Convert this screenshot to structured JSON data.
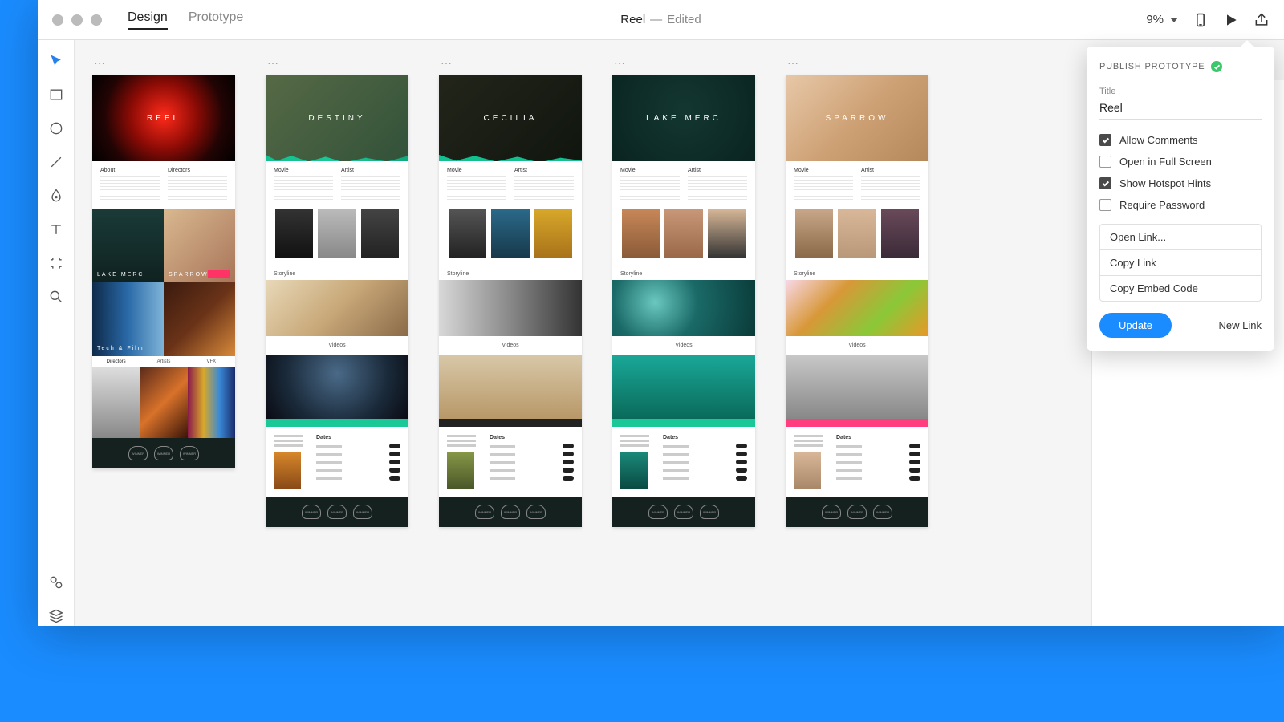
{
  "header": {
    "tabs": {
      "design": "Design",
      "prototype": "Prototype"
    },
    "doc_name": "Reel",
    "doc_sep": "—",
    "doc_status": "Edited",
    "zoom": "9%"
  },
  "tools": {
    "select": "select",
    "rect": "rectangle",
    "ellipse": "ellipse",
    "line": "line",
    "pen": "pen",
    "text": "text",
    "artboard": "artboard",
    "zoom": "zoom",
    "assets": "assets",
    "layers": "layers"
  },
  "artboards": [
    {
      "title": "REEL",
      "cols": [
        "About",
        "Directors"
      ],
      "cells": [
        "LAKE MERC",
        "SPARROW",
        "Tech & Film",
        ""
      ],
      "tabs": [
        "Directors",
        "Artists",
        "VFX"
      ]
    },
    {
      "title": "DESTINY",
      "cols": [
        "Movie",
        "Artist"
      ],
      "section": "Storyline",
      "videos": "Videos",
      "dates": "Dates"
    },
    {
      "title": "CECILIA",
      "cols": [
        "Movie",
        "Artist"
      ],
      "section": "Storyline",
      "videos": "Videos",
      "dates": "Dates"
    },
    {
      "title": "LAKE MERC",
      "cols": [
        "Movie",
        "Artist"
      ],
      "section": "Storyline",
      "videos": "Videos",
      "dates": "Dates"
    },
    {
      "title": "SPARROW",
      "cols": [
        "Movie",
        "Artist"
      ],
      "section": "Storyline",
      "videos": "Videos",
      "dates": "Dates"
    }
  ],
  "footer_badge": "WINNER",
  "popover": {
    "heading": "PUBLISH PROTOTYPE",
    "title_label": "Title",
    "title_value": "Reel",
    "allow_comments": "Allow Comments",
    "fullscreen": "Open in Full Screen",
    "hotspots": "Show Hotspot Hints",
    "password": "Require Password",
    "open_link": "Open Link...",
    "copy_link": "Copy Link",
    "copy_embed": "Copy Embed Code",
    "update": "Update",
    "new_link": "New Link"
  }
}
